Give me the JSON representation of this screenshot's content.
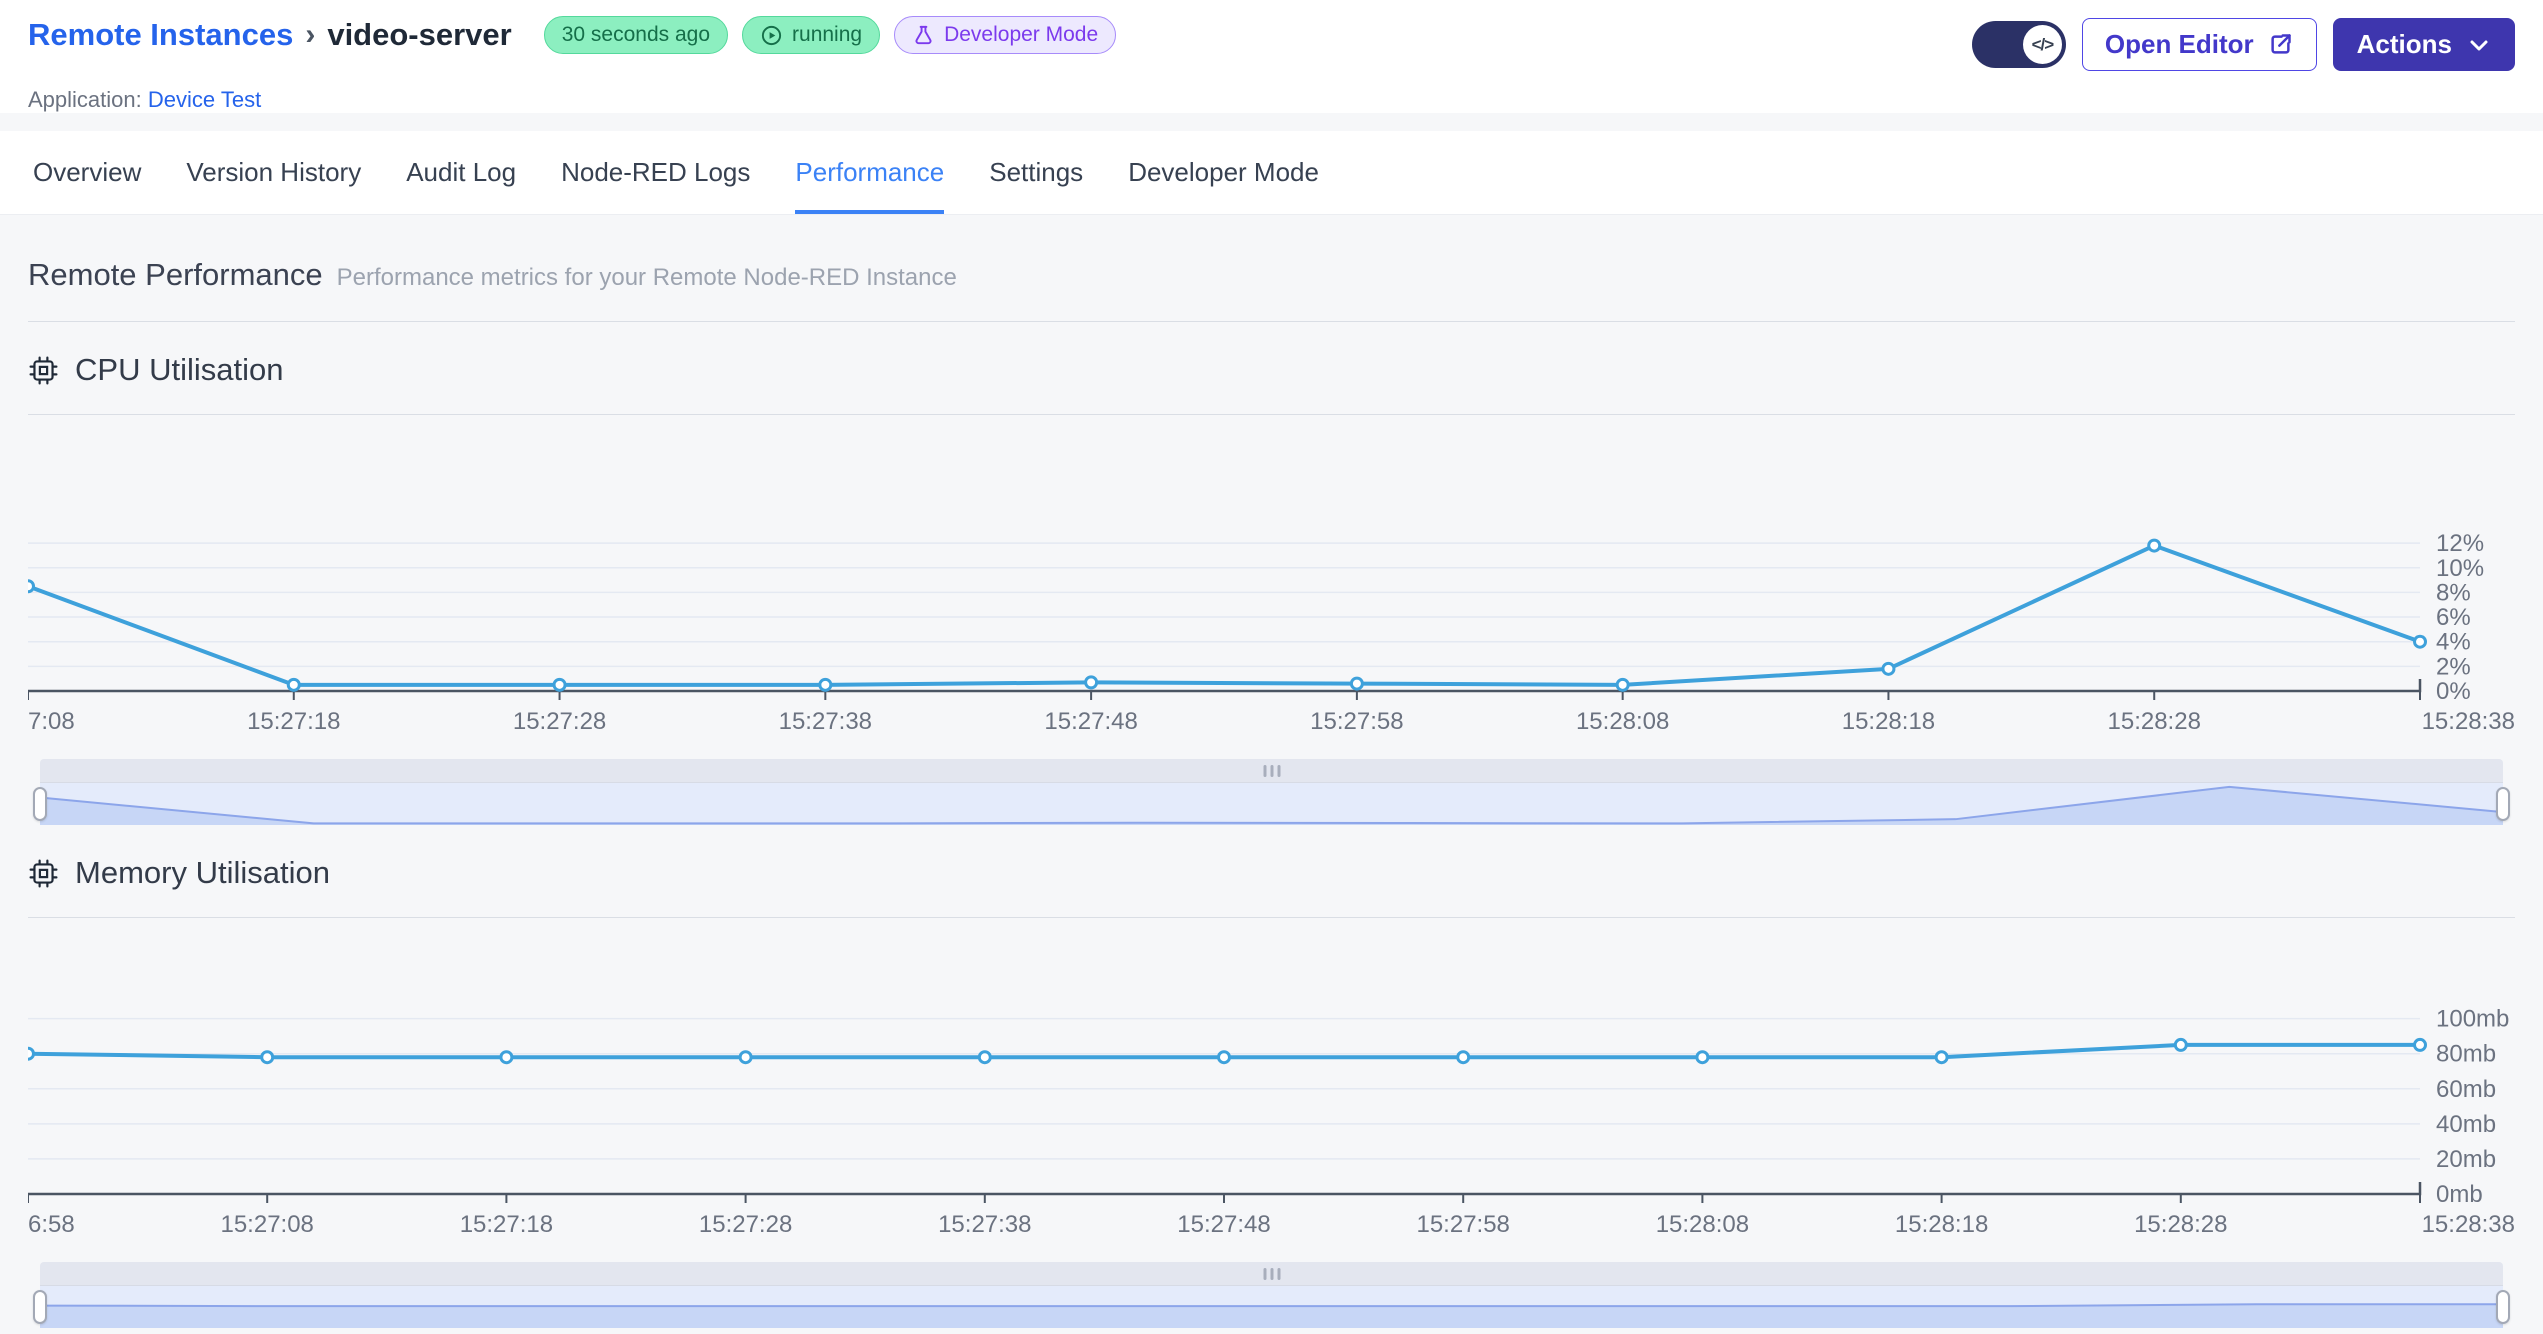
{
  "header": {
    "breadcrumb": {
      "parent": "Remote Instances",
      "separator": "›",
      "current": "video-server"
    },
    "application": {
      "label": "Application:",
      "name": "Device Test"
    },
    "badges": {
      "last_seen": "30 seconds ago",
      "status": "running",
      "mode": "Developer Mode"
    },
    "toggle_icon": "</>",
    "open_editor_label": "Open Editor",
    "actions_label": "Actions"
  },
  "tabs": {
    "items": [
      {
        "label": "Overview",
        "active": false
      },
      {
        "label": "Version History",
        "active": false
      },
      {
        "label": "Audit Log",
        "active": false
      },
      {
        "label": "Node-RED Logs",
        "active": false
      },
      {
        "label": "Performance",
        "active": true
      },
      {
        "label": "Settings",
        "active": false
      },
      {
        "label": "Developer Mode",
        "active": false
      }
    ]
  },
  "page": {
    "title": "Remote Performance",
    "subtitle": "Performance metrics for your Remote Node-RED Instance"
  },
  "icons": {
    "status_badge": "play-circle-icon",
    "mode_badge": "flask-icon",
    "toggle": "code-icon",
    "open_editor": "external-link-icon",
    "actions": "chevron-down-icon",
    "section": "cpu-chip-icon",
    "brush": "grip-icon"
  },
  "colors": {
    "link_blue": "#2563EB",
    "active_tab_blue": "#3B82F6",
    "chart_line_blue": "#3EA1DB",
    "badge_green_bg": "#8CEFC0",
    "badge_green_text": "#156F49",
    "badge_purple_bg": "#EDE9FE",
    "badge_purple_text": "#7C3AED",
    "actions_button_bg": "#3E36AE",
    "brush_area_fill": "#C7D6F6",
    "brush_line": "#8CA5EA"
  },
  "chart_data": [
    {
      "type": "line",
      "title": "CPU Utilisation",
      "x": [
        "7:08",
        "15:27:18",
        "15:27:28",
        "15:27:38",
        "15:27:48",
        "15:27:58",
        "15:28:08",
        "15:28:18",
        "15:28:28",
        "15:28:38"
      ],
      "values": [
        8.5,
        0.5,
        0.5,
        0.5,
        0.7,
        0.6,
        0.5,
        1.8,
        11.8,
        4.0
      ],
      "ylabel": "%",
      "ytick_values": [
        0,
        2,
        4,
        6,
        8,
        10,
        12
      ],
      "ytick_labels": [
        "0%",
        "2%",
        "4%",
        "6%",
        "8%",
        "10%",
        "12%"
      ],
      "ylim": [
        0,
        12
      ],
      "grid": true,
      "legend": "none",
      "line_color": "#3EA1DB"
    },
    {
      "type": "line",
      "title": "Memory Utilisation",
      "x": [
        "6:58",
        "15:27:08",
        "15:27:18",
        "15:27:28",
        "15:27:38",
        "15:27:48",
        "15:27:58",
        "15:28:08",
        "15:28:18",
        "15:28:28",
        "15:28:38"
      ],
      "values": [
        80,
        78,
        78,
        78,
        78,
        78,
        78,
        78,
        78,
        85,
        85
      ],
      "ylabel": "mb",
      "ytick_values": [
        0,
        20,
        40,
        60,
        80,
        100
      ],
      "ytick_labels": [
        "0mb",
        "20mb",
        "40mb",
        "60mb",
        "80mb",
        "100mb"
      ],
      "ylim": [
        0,
        100
      ],
      "grid": true,
      "legend": "none",
      "line_color": "#3EA1DB"
    }
  ]
}
